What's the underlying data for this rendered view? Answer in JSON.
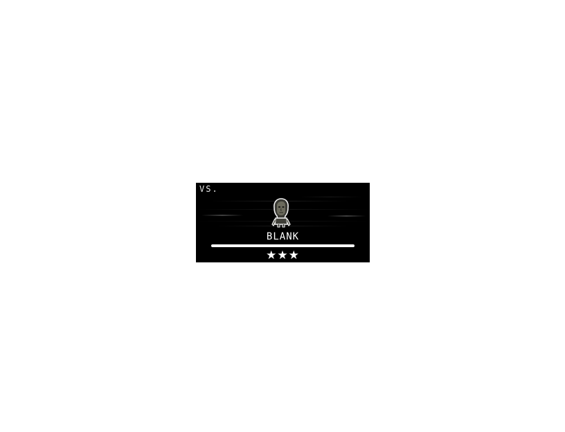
{
  "encounter": {
    "vs_label": "VS.",
    "enemy_name": "BLANK",
    "difficulty_stars": "★★★",
    "difficulty_rating": 3
  },
  "colors": {
    "card_background": "#000000",
    "text": "#ffffff",
    "page_background": "#ffffff"
  },
  "icons": {
    "portrait": "enemy-portrait-icon"
  }
}
